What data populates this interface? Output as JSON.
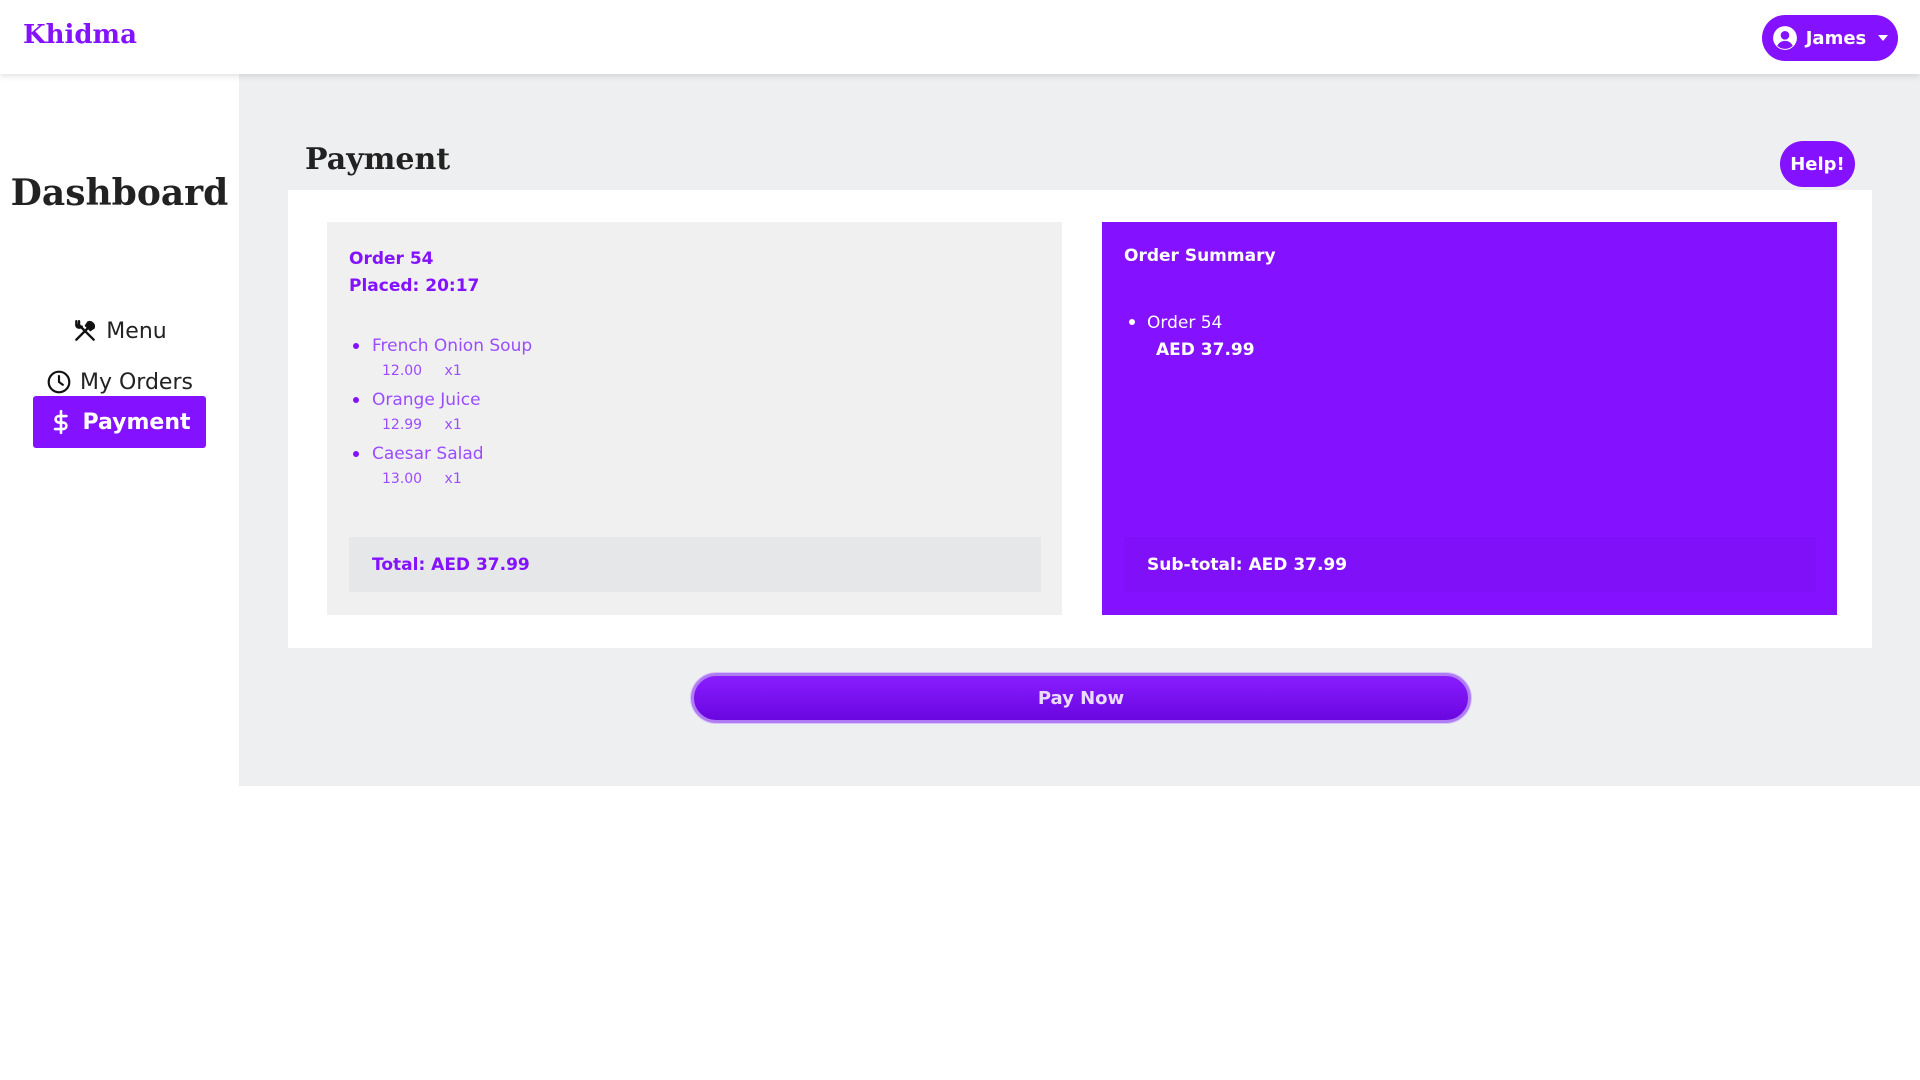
{
  "navbar": {
    "brand": "Khidma",
    "user_name": "James"
  },
  "sidebar": {
    "title": "Dashboard",
    "items": [
      {
        "label": "Menu",
        "icon": "utensils-icon",
        "active": false
      },
      {
        "label": "My Orders",
        "icon": "clock-icon",
        "active": false
      },
      {
        "label": "Payment",
        "icon": "dollar-icon",
        "active": true
      }
    ]
  },
  "main": {
    "title": "Payment",
    "help_label": "Help!",
    "order": {
      "number": "Order 54",
      "placed": "Placed: 20:17",
      "items": [
        {
          "name": "French Onion Soup",
          "price": "12.00",
          "qty": "x1"
        },
        {
          "name": "Orange Juice",
          "price": "12.99",
          "qty": "x1"
        },
        {
          "name": "Caesar Salad",
          "price": "13.00",
          "qty": "x1"
        }
      ],
      "total": "Total: AED 37.99"
    },
    "summary": {
      "title": "Order Summary",
      "entries": [
        {
          "order": "Order 54",
          "amount": "AED 37.99"
        }
      ],
      "subtotal": "Sub-total: AED 37.99"
    },
    "pay_label": "Pay Now"
  },
  "colors": {
    "accent": "#8411ff",
    "background": "#eeeff1",
    "panel": "#f0f0f1"
  }
}
